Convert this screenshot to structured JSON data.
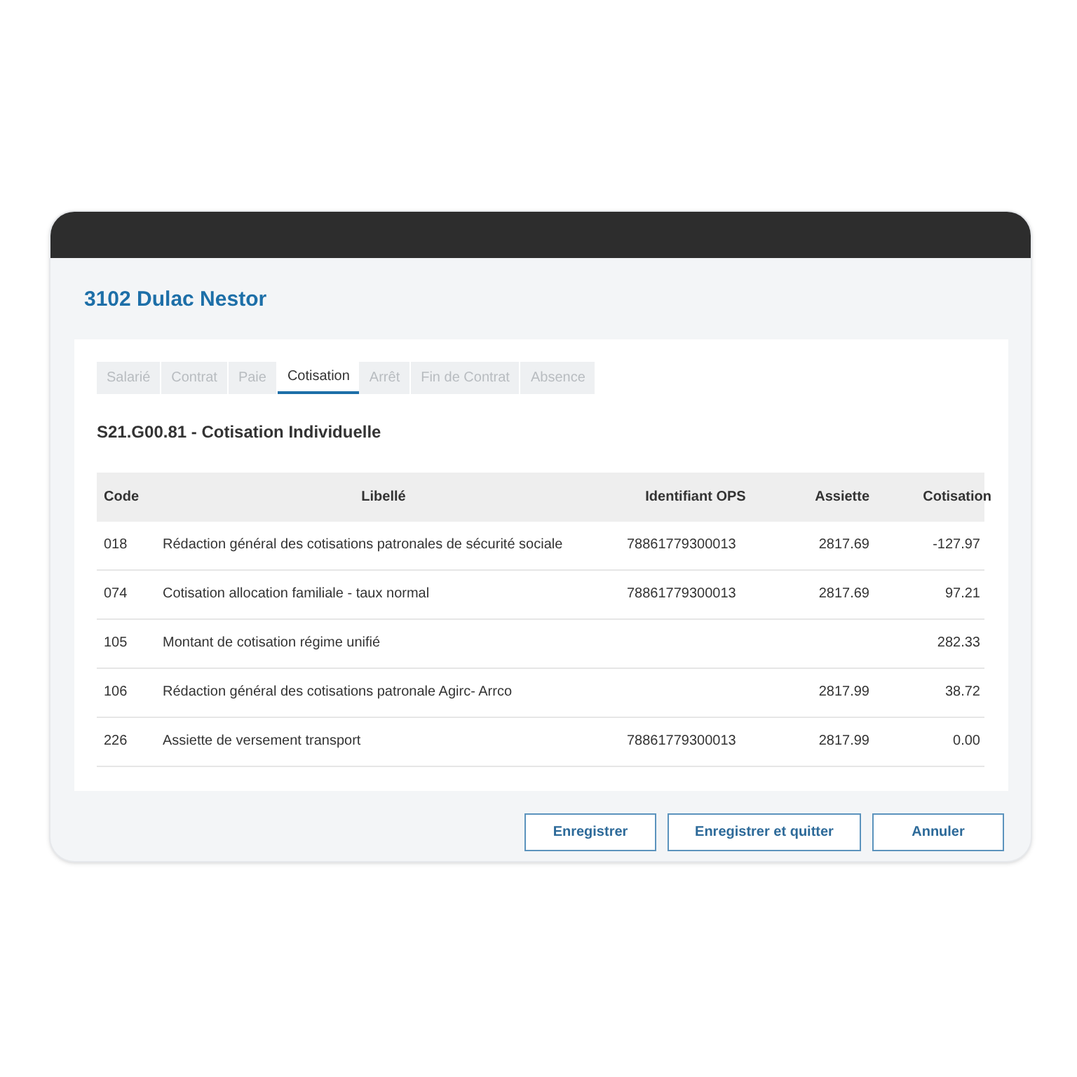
{
  "window": {
    "title": "3102 Dulac Nestor"
  },
  "tabs": [
    {
      "label": "Salarié",
      "selected": false
    },
    {
      "label": "Contrat",
      "selected": false
    },
    {
      "label": "Paie",
      "selected": false
    },
    {
      "label": "Cotisation",
      "selected": true
    },
    {
      "label": "Arrêt",
      "selected": false
    },
    {
      "label": "Fin de Contrat",
      "selected": false
    },
    {
      "label": "Absence",
      "selected": false
    }
  ],
  "section_title": "S21.G00.81 - Cotisation Individuelle",
  "table": {
    "columns": [
      "Code",
      "Libellé",
      "Identifiant OPS",
      "Assiette",
      "Cotisation"
    ],
    "rows": [
      [
        "018",
        "Rédaction général des cotisations patronales de sécurité sociale",
        "78861779300013",
        "2817.69",
        "-127.97"
      ],
      [
        "074",
        "Cotisation allocation familiale - taux normal",
        "78861779300013",
        "2817.69",
        "97.21"
      ],
      [
        "105",
        "Montant de cotisation régime unifié",
        "",
        "",
        "282.33"
      ],
      [
        "106",
        "Rédaction général des cotisations patronale Agirc- Arrco",
        "",
        "2817.99",
        "38.72"
      ],
      [
        "226",
        "Assiette de versement transport",
        "78861779300013",
        "2817.99",
        "0.00"
      ]
    ]
  },
  "buttons": [
    "Enregistrer",
    "Enregistrer et quitter",
    "Annuler"
  ]
}
